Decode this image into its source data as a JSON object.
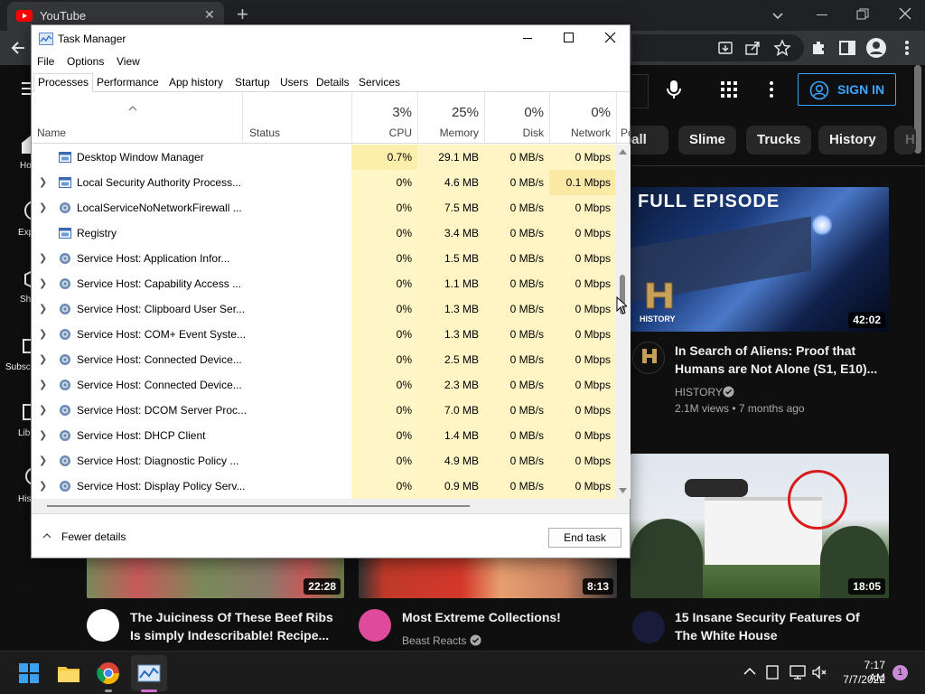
{
  "browser": {
    "tab_title": "YouTube",
    "new_tab_symbol": "+",
    "close_symbol": "✕"
  },
  "youtube": {
    "sign_in_label": "SIGN IN",
    "chips": [
      "ball",
      "Slime",
      "Trucks",
      "History",
      "H"
    ],
    "left_nav": [
      "Ho",
      "Exp",
      "Sh",
      "Subsc",
      "Lib",
      "His"
    ],
    "videos": [
      {
        "title_line1": "In Search of Aliens: Proof that",
        "title_line2": "Humans are Not Alone (S1, E10)...",
        "channel": "HISTORY",
        "meta": "2.1M views • 7 months ago",
        "duration": "42:02",
        "thumb_label": "FULL EPISODE",
        "thumb_brand": "HISTORY"
      },
      {
        "duration": "18:05"
      },
      {
        "title_line1": "The Juiciness Of These Beef Ribs",
        "title_line2": "Is simply Indescribable! Recipe...",
        "duration": "22:28"
      },
      {
        "title_line1": "Most Extreme Collections!",
        "channel": "Beast Reacts",
        "duration": "8:13"
      },
      {
        "title_line1": "15 Insane Security Features Of",
        "title_line2": "The White House"
      }
    ]
  },
  "taskmgr": {
    "title": "Task Manager",
    "menu": [
      "File",
      "Options",
      "View"
    ],
    "tabs": [
      "Processes",
      "Performance",
      "App history",
      "Startup",
      "Users",
      "Details",
      "Services"
    ],
    "columns": {
      "name": "Name",
      "status": "Status",
      "cpu_pct": "3%",
      "cpu": "CPU",
      "mem_pct": "25%",
      "mem": "Memory",
      "disk_pct": "0%",
      "disk": "Disk",
      "net_pct": "0%",
      "net": "Network",
      "power": "Po"
    },
    "rows": [
      {
        "name": "Desktop Window Manager",
        "cpu": "0.7%",
        "mem": "29.1 MB",
        "disk": "0 MB/s",
        "net": "0 Mbps",
        "expand": false,
        "icon": "app-window-icon"
      },
      {
        "name": "Local Security Authority Process...",
        "cpu": "0%",
        "mem": "4.6 MB",
        "disk": "0 MB/s",
        "net": "0.1 Mbps",
        "expand": true,
        "icon": "app-window-icon"
      },
      {
        "name": "LocalServiceNoNetworkFirewall ...",
        "cpu": "0%",
        "mem": "7.5 MB",
        "disk": "0 MB/s",
        "net": "0 Mbps",
        "expand": true,
        "icon": "gear-icon"
      },
      {
        "name": "Registry",
        "cpu": "0%",
        "mem": "3.4 MB",
        "disk": "0 MB/s",
        "net": "0 Mbps",
        "expand": false,
        "icon": "app-window-icon"
      },
      {
        "name": "Service Host: Application Infor...",
        "cpu": "0%",
        "mem": "1.5 MB",
        "disk": "0 MB/s",
        "net": "0 Mbps",
        "expand": true,
        "icon": "gear-icon"
      },
      {
        "name": "Service Host: Capability Access ...",
        "cpu": "0%",
        "mem": "1.1 MB",
        "disk": "0 MB/s",
        "net": "0 Mbps",
        "expand": true,
        "icon": "gear-icon"
      },
      {
        "name": "Service Host: Clipboard User Ser...",
        "cpu": "0%",
        "mem": "1.3 MB",
        "disk": "0 MB/s",
        "net": "0 Mbps",
        "expand": true,
        "icon": "gear-icon"
      },
      {
        "name": "Service Host: COM+ Event Syste...",
        "cpu": "0%",
        "mem": "1.3 MB",
        "disk": "0 MB/s",
        "net": "0 Mbps",
        "expand": true,
        "icon": "gear-icon"
      },
      {
        "name": "Service Host: Connected Device...",
        "cpu": "0%",
        "mem": "2.5 MB",
        "disk": "0 MB/s",
        "net": "0 Mbps",
        "expand": true,
        "icon": "gear-icon"
      },
      {
        "name": "Service Host: Connected Device...",
        "cpu": "0%",
        "mem": "2.3 MB",
        "disk": "0 MB/s",
        "net": "0 Mbps",
        "expand": true,
        "icon": "gear-icon"
      },
      {
        "name": "Service Host: DCOM Server Proc...",
        "cpu": "0%",
        "mem": "7.0 MB",
        "disk": "0 MB/s",
        "net": "0 Mbps",
        "expand": true,
        "icon": "gear-icon"
      },
      {
        "name": "Service Host: DHCP Client",
        "cpu": "0%",
        "mem": "1.4 MB",
        "disk": "0 MB/s",
        "net": "0 Mbps",
        "expand": true,
        "icon": "gear-icon"
      },
      {
        "name": "Service Host: Diagnostic Policy ...",
        "cpu": "0%",
        "mem": "4.9 MB",
        "disk": "0 MB/s",
        "net": "0 Mbps",
        "expand": true,
        "icon": "gear-icon"
      },
      {
        "name": "Service Host: Display Policy Serv...",
        "cpu": "0%",
        "mem": "0.9 MB",
        "disk": "0 MB/s",
        "net": "0 Mbps",
        "expand": true,
        "icon": "gear-icon"
      }
    ],
    "fewer_details": "Fewer details",
    "end_task": "End task"
  },
  "taskbar": {
    "time": "7:17 AM",
    "date": "7/7/2022",
    "notification_count": "1"
  },
  "colors": {
    "yt_bg": "#0f0f0f",
    "signin_blue": "#3ea6ff",
    "heatmap_light": "#fff4c4",
    "heatmap_mid": "#fcefac"
  }
}
